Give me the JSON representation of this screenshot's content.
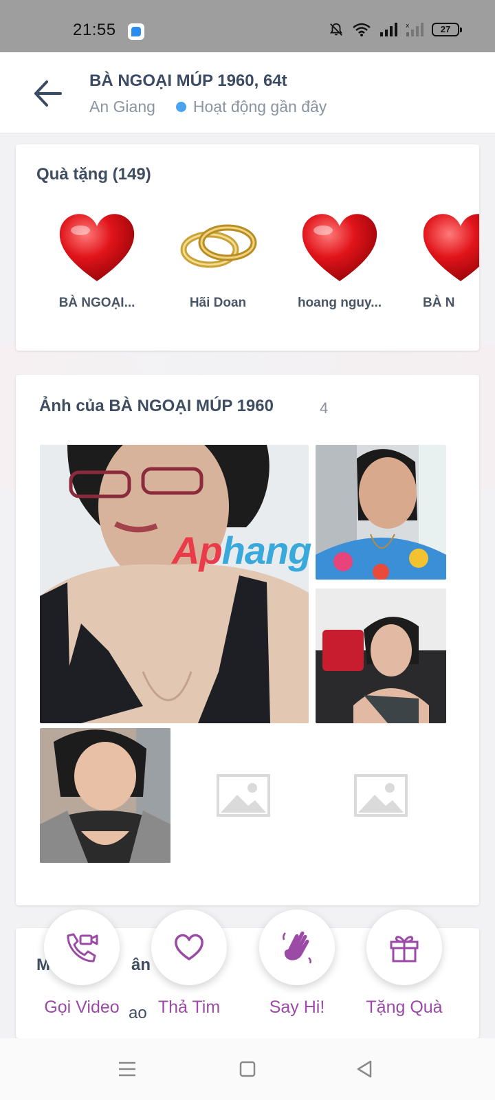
{
  "status": {
    "time": "21:55",
    "battery": "27"
  },
  "header": {
    "title": "BÀ NGOẠI MÚP 1960, 64t",
    "location": "An Giang",
    "activity": "Hoạt động gần đây"
  },
  "gifts": {
    "heading": "Quà tặng (149)",
    "items": [
      {
        "name": "BÀ NGOẠI...",
        "icon": "heart-gift-icon"
      },
      {
        "name": "Hãi Doan",
        "icon": "rings-gift-icon"
      },
      {
        "name": "hoang nguy...",
        "icon": "heart-gift-icon"
      },
      {
        "name": "BÀ N",
        "icon": "heart-gift-icon"
      }
    ]
  },
  "photos": {
    "heading": "Ảnh của BÀ NGOẠI MÚP 1960",
    "count": "4"
  },
  "watermark": {
    "part1": "Ap",
    "part2": "hang"
  },
  "about": {
    "heading_start": "M",
    "heading_end": "ân T",
    "partial": "ao"
  },
  "actions": [
    {
      "label": "Gọi Video",
      "icon": "video-call-icon"
    },
    {
      "label": "Thả Tim",
      "icon": "heart-outline-icon"
    },
    {
      "label": "Say Hi!",
      "icon": "wave-hand-icon"
    },
    {
      "label": "Tặng Quà",
      "icon": "gift-box-icon"
    }
  ],
  "colors": {
    "accent": "#9b4ba6",
    "online_dot": "#4aa3ef",
    "heading": "#3f4d62"
  }
}
